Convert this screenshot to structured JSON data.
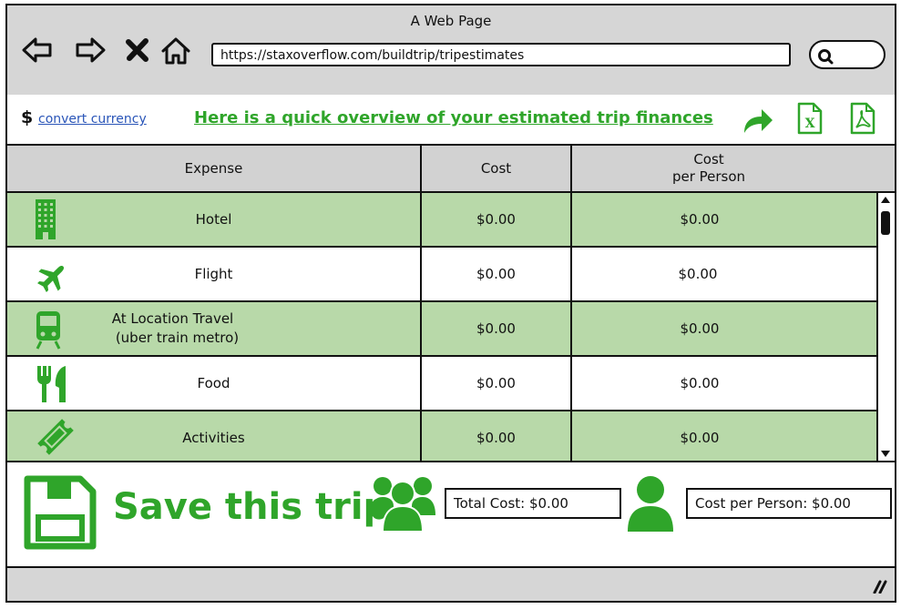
{
  "window": {
    "title": "A Web Page"
  },
  "browser": {
    "url": "https://staxoverflow.com/buildtrip/tripestimates",
    "back_icon": "arrow-left-icon",
    "forward_icon": "arrow-right-icon",
    "stop_icon": "close-icon",
    "home_icon": "home-icon",
    "search_icon": "search-icon"
  },
  "toolbar": {
    "currency_symbol": "$",
    "convert_label": "convert currency",
    "overview_text": "Here is a quick overview of your estimated trip finances",
    "share_icon": "share-icon",
    "excel_icon": "excel-export-icon",
    "pdf_icon": "pdf-export-icon"
  },
  "table": {
    "headers": {
      "expense": "Expense",
      "cost": "Cost",
      "cost_per_person_line1": "Cost",
      "cost_per_person_line2": "per Person"
    },
    "rows": [
      {
        "icon": "hotel-icon",
        "expense": "Hotel",
        "cost": "$0.00",
        "per_person": "$0.00"
      },
      {
        "icon": "airplane-icon",
        "expense": "Flight",
        "cost": "$0.00",
        "per_person": "$0.00"
      },
      {
        "icon": "train-icon",
        "expense_line1": "At Location Travel",
        "expense_line2": "(uber train metro)",
        "cost": "$0.00",
        "per_person": "$0.00"
      },
      {
        "icon": "utensils-icon",
        "expense": "Food",
        "cost": "$0.00",
        "per_person": "$0.00"
      },
      {
        "icon": "ticket-icon",
        "expense": "Activities",
        "cost": "$0.00",
        "per_person": "$0.00"
      }
    ]
  },
  "footer": {
    "save_label": "Save this trip",
    "save_icon": "floppy-disk-icon",
    "group_icon": "group-icon",
    "person_icon": "person-icon",
    "total_cost": "Total Cost: $0.00",
    "cost_per_person": "Cost per Person: $0.00"
  },
  "colors": {
    "accent_green": "#2fa52a",
    "row_green": "#b8d9a9",
    "chrome_gray": "#d6d6d6",
    "link_blue": "#2a55b8"
  }
}
